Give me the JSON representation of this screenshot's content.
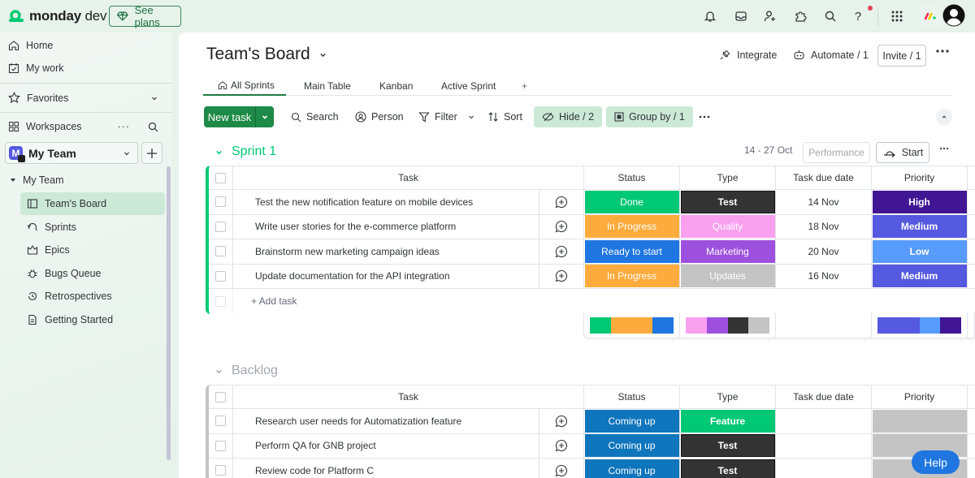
{
  "topbar": {
    "logo_bold": "monday",
    "logo_light": " dev",
    "see_plans": "See plans",
    "icons": [
      "bell-icon",
      "inbox-icon",
      "invite-member-icon",
      "apps-puzzle-icon",
      "search-icon",
      "help-icon",
      "app-grid-icon"
    ],
    "has_notification_dot": true
  },
  "sidebar": {
    "nav": [
      {
        "label": "Home",
        "icon": "home-icon"
      },
      {
        "label": "My work",
        "icon": "calendar-check-icon"
      }
    ],
    "favorites": "Favorites",
    "workspaces": "Workspaces",
    "workspace_selected": "My Team",
    "workspace_initial": "M",
    "tree_root": "My Team",
    "tree_items": [
      {
        "label": "Team's Board",
        "icon": "board-icon",
        "active": true
      },
      {
        "label": "Sprints",
        "icon": "sprint-icon",
        "active": false
      },
      {
        "label": "Epics",
        "icon": "epic-icon",
        "active": false
      },
      {
        "label": "Bugs Queue",
        "icon": "bug-icon",
        "active": false
      },
      {
        "label": "Retrospectives",
        "icon": "history-icon",
        "active": false
      },
      {
        "label": "Getting Started",
        "icon": "document-icon",
        "active": false
      }
    ]
  },
  "board": {
    "title": "Team's Board",
    "actions": {
      "integrate": "Integrate",
      "automate": "Automate / 1",
      "invite": "Invite / 1"
    },
    "tabs": [
      "All Sprints",
      "Main Table",
      "Kanban",
      "Active Sprint",
      "+"
    ],
    "active_tab": "All Sprints",
    "toolbar": {
      "new_task": "New task",
      "search": "Search",
      "person": "Person",
      "filter": "Filter",
      "sort": "Sort",
      "hide": "Hide / 2",
      "group_by": "Group by / 1"
    }
  },
  "columns": [
    "Task",
    "Status",
    "Type",
    "Task due date",
    "Priority"
  ],
  "colors": {
    "Done": "#00c875",
    "In Progress": "#fdab3d",
    "Ready to start": "#1f76e0",
    "Coming up": "#0f75bc",
    "Test": "#333333",
    "Quality": "#f9a0ef",
    "Marketing": "#9d50dd",
    "Updates": "#c4c4c4",
    "Feature": "#00c875",
    "High": "#401694",
    "Medium": "#5559df",
    "Low": "#579bfc",
    "empty": "#c4c4c4"
  },
  "groups": [
    {
      "name": "Sprint 1",
      "color": "#00c875",
      "dates": "14 - 27 Oct",
      "performance": "Performance",
      "start": "Start",
      "rows": [
        {
          "task": "Test the new notification feature on mobile devices",
          "status": "Done",
          "type": "Test",
          "date": "14 Nov",
          "priority": "High"
        },
        {
          "task": "Write user stories for the e-commerce platform",
          "status": "In Progress",
          "type": "Quality",
          "date": "18 Nov",
          "priority": "Medium"
        },
        {
          "task": "Brainstorm new marketing campaign ideas",
          "status": "Ready to start",
          "type": "Marketing",
          "date": "20 Nov",
          "priority": "Low"
        },
        {
          "task": "Update documentation for the API integration",
          "status": "In Progress",
          "type": "Updates",
          "date": "16 Nov",
          "priority": "Medium"
        }
      ],
      "add_task": "+ Add task",
      "summary": {
        "status": [
          {
            "label": "Done",
            "fraction": 0.25
          },
          {
            "label": "In Progress",
            "fraction": 0.5
          },
          {
            "label": "Ready to start",
            "fraction": 0.25
          }
        ],
        "type": [
          {
            "label": "Quality",
            "fraction": 0.25
          },
          {
            "label": "Marketing",
            "fraction": 0.25
          },
          {
            "label": "Test",
            "fraction": 0.25
          },
          {
            "label": "Updates",
            "fraction": 0.25
          }
        ],
        "priority": [
          {
            "label": "Medium",
            "fraction": 0.5
          },
          {
            "label": "Low",
            "fraction": 0.25
          },
          {
            "label": "High",
            "fraction": 0.25
          }
        ]
      }
    },
    {
      "name": "Backlog",
      "color": "#c4c4c4",
      "rows": [
        {
          "task": "Research user needs for Automatization feature",
          "status": "Coming up",
          "type": "Feature",
          "date": "",
          "priority": ""
        },
        {
          "task": "Perform QA for GNB project",
          "status": "Coming up",
          "type": "Test",
          "date": "",
          "priority": ""
        },
        {
          "task": "Review code for Platform C",
          "status": "Coming up",
          "type": "Test",
          "date": "",
          "priority": ""
        }
      ]
    }
  ],
  "help": "Help"
}
